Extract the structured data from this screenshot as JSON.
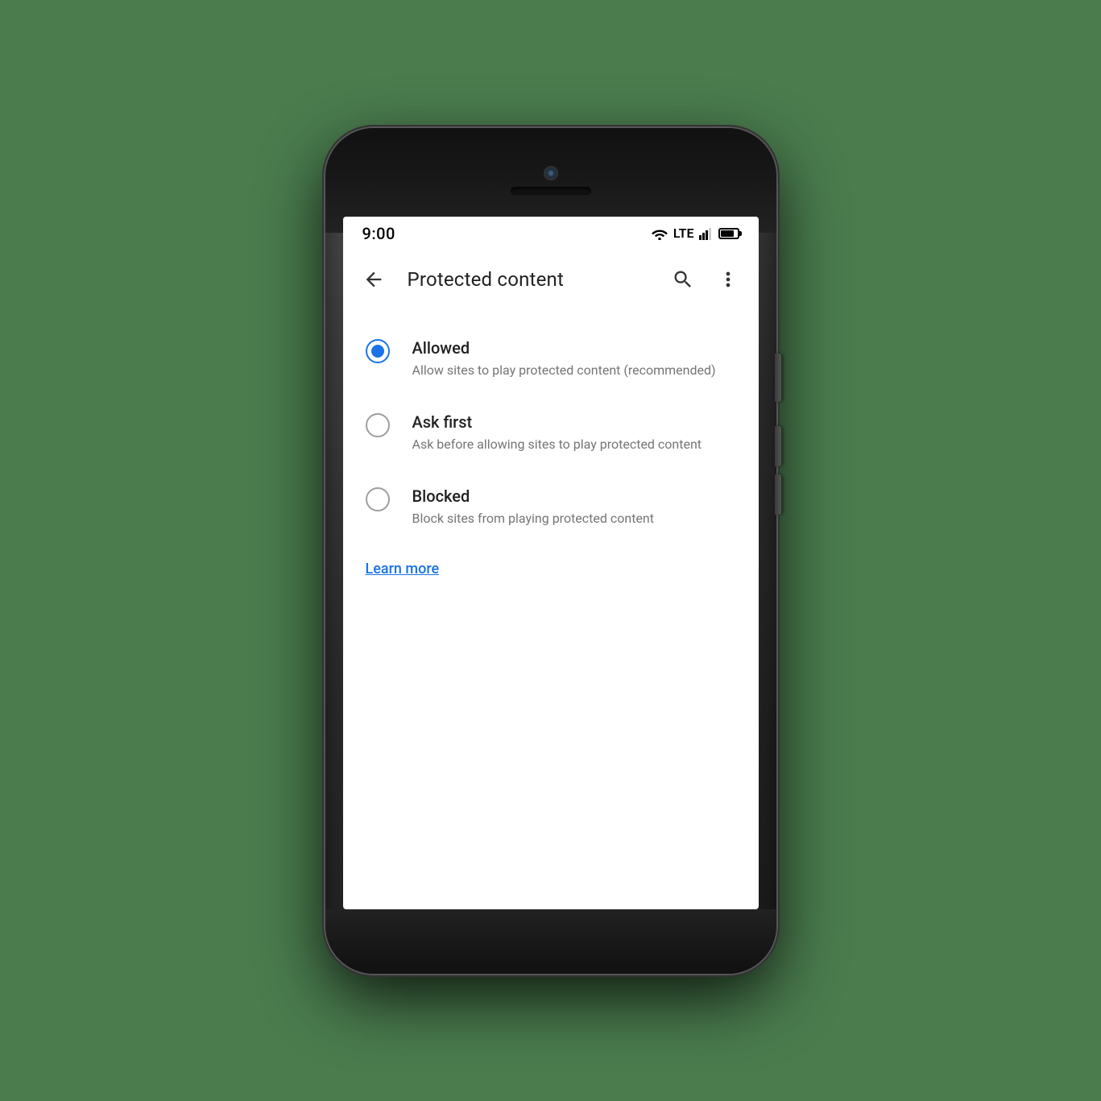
{
  "status_bar": {
    "time": "9:00",
    "lte_label": "LTE"
  },
  "app_bar": {
    "title": "Protected content",
    "back_label": "back",
    "search_label": "search",
    "more_label": "more options"
  },
  "options": [
    {
      "id": "allowed",
      "title": "Allowed",
      "description": "Allow sites to play protected content (recommended)",
      "selected": true
    },
    {
      "id": "ask-first",
      "title": "Ask first",
      "description": "Ask before allowing sites to play protected content",
      "selected": false
    },
    {
      "id": "blocked",
      "title": "Blocked",
      "description": "Block sites from playing protected content",
      "selected": false
    }
  ],
  "learn_more": {
    "label": "Learn more",
    "color": "#1a73e8"
  }
}
